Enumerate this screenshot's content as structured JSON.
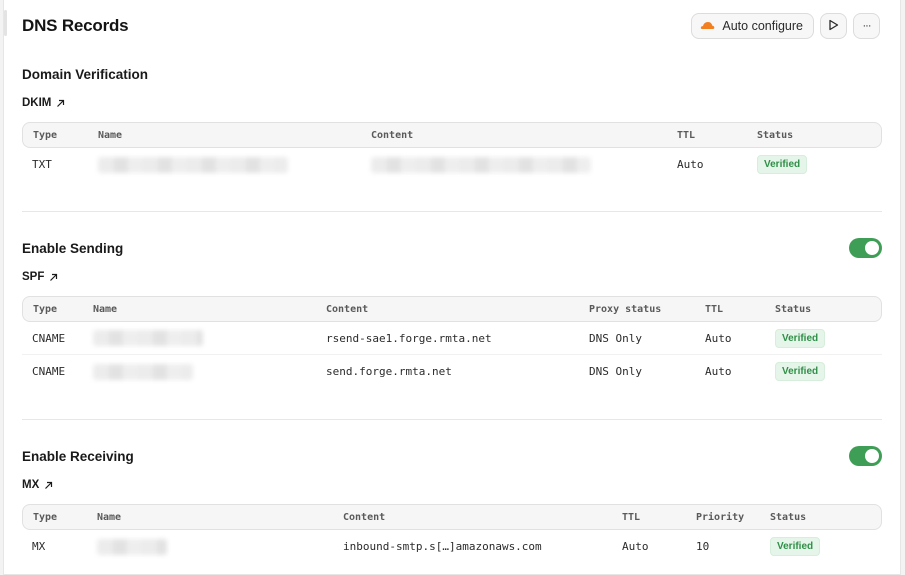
{
  "header": {
    "title": "DNS Records",
    "auto_configure_label": "Auto configure",
    "more_label": "···"
  },
  "colors": {
    "verified_bg": "#e6f5e9",
    "verified_text": "#2f8f48",
    "toggle_on": "#3f9e55",
    "cloudflare_orange": "#f38020"
  },
  "domain_verification": {
    "title": "Domain Verification",
    "link_label": "DKIM",
    "columns": [
      "Type",
      "Name",
      "Content",
      "TTL",
      "Status"
    ],
    "rows": [
      {
        "type": "TXT",
        "ttl": "Auto",
        "status": "Verified"
      }
    ]
  },
  "sending": {
    "title": "Enable Sending",
    "enabled": true,
    "link_label": "SPF",
    "columns": [
      "Type",
      "Name",
      "Content",
      "Proxy status",
      "TTL",
      "Status"
    ],
    "rows": [
      {
        "type": "CNAME",
        "content": "rsend-sae1.forge.rmta.net",
        "proxy": "DNS Only",
        "ttl": "Auto",
        "status": "Verified"
      },
      {
        "type": "CNAME",
        "content": "send.forge.rmta.net",
        "proxy": "DNS Only",
        "ttl": "Auto",
        "status": "Verified"
      }
    ]
  },
  "receiving": {
    "title": "Enable Receiving",
    "enabled": true,
    "link_label": "MX",
    "columns": [
      "Type",
      "Name",
      "Content",
      "TTL",
      "Priority",
      "Status"
    ],
    "rows": [
      {
        "type": "MX",
        "content": "inbound-smtp.s[…]amazonaws.com",
        "ttl": "Auto",
        "priority": "10",
        "status": "Verified"
      }
    ]
  }
}
